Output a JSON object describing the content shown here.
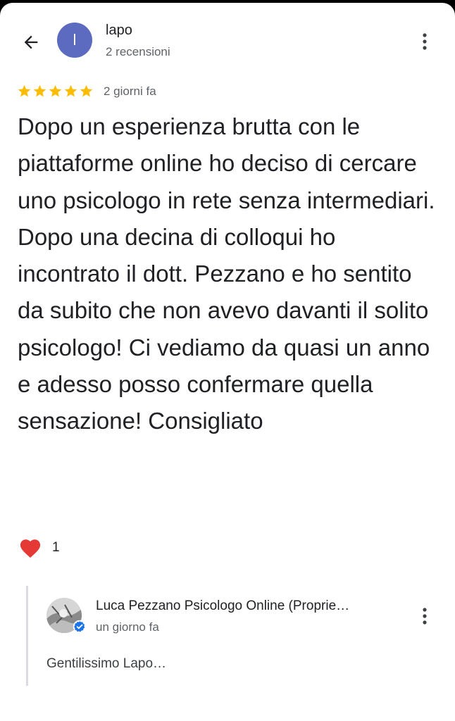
{
  "header": {
    "back_icon": "arrow-back-icon",
    "avatar_letter": "l",
    "avatar_color": "#5c6bc0",
    "reviewer_name": "lapo",
    "reviewer_reviews": "2 recensioni",
    "more_icon": "more-vert-icon"
  },
  "review": {
    "rating": 5,
    "rating_max": 5,
    "star_color": "#fbbc04",
    "date": "2 giorni fa",
    "text": "Dopo un esperienza brutta con le piattaforme online ho deciso di cercare uno psicologo in rete senza intermediari. Dopo una decina di colloqui ho incontrato il dott. Pezzano e ho sentito da subito che non avevo davanti il solito psicologo! Ci vediamo da quasi un anno e adesso posso confermare quella sensazione! Consigliato"
  },
  "reaction": {
    "icon": "heart-icon",
    "color": "#e53935",
    "count": "1"
  },
  "owner_reply": {
    "name": "Luca Pezzano Psicologo Online (Proprie…",
    "verified_icon": "verified-badge-icon",
    "verified_color": "#1a73e8",
    "date": "un giorno fa",
    "text": "Gentilissimo Lapo…"
  }
}
